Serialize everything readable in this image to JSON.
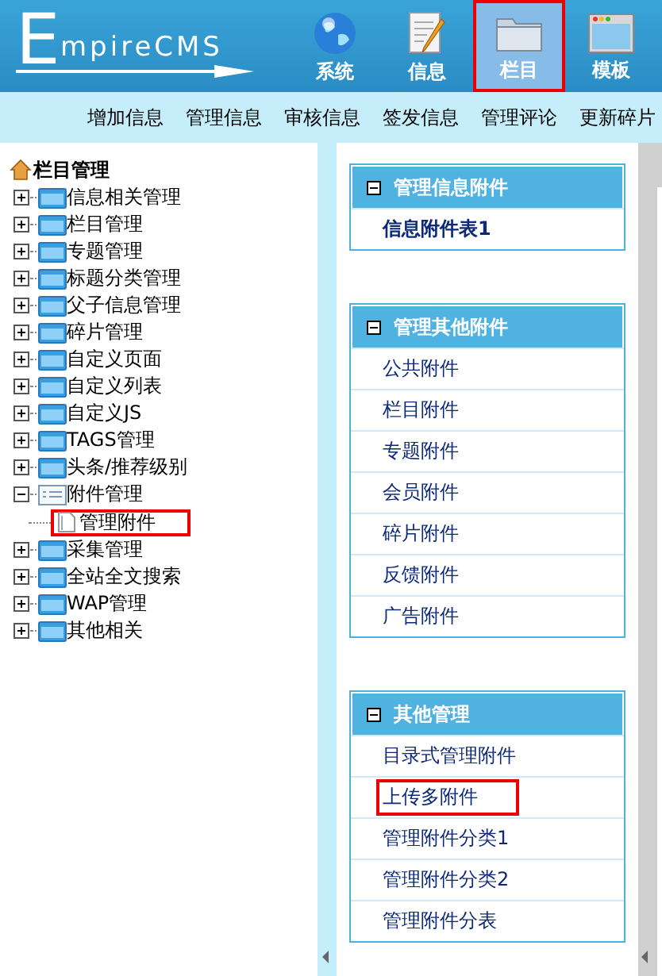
{
  "header": {
    "logo": {
      "initial": "E",
      "rest": "mpireCMS"
    },
    "menu": [
      {
        "label": "系统",
        "kind": "globe",
        "selected": false
      },
      {
        "label": "信息",
        "kind": "notepad",
        "selected": false
      },
      {
        "label": "栏目",
        "kind": "folder",
        "selected": true
      },
      {
        "label": "模板",
        "kind": "window",
        "selected": false
      }
    ]
  },
  "toolbar": [
    "增加信息",
    "管理信息",
    "审核信息",
    "签发信息",
    "管理评论",
    "更新碎片"
  ],
  "tree": {
    "title": "栏目管理",
    "items": [
      {
        "label": "信息相关管理",
        "expanded": false
      },
      {
        "label": "栏目管理",
        "expanded": false
      },
      {
        "label": "专题管理",
        "expanded": false
      },
      {
        "label": "标题分类管理",
        "expanded": false
      },
      {
        "label": "父子信息管理",
        "expanded": false
      },
      {
        "label": "碎片管理",
        "expanded": false
      },
      {
        "label": "自定义页面",
        "expanded": false
      },
      {
        "label": "自定义列表",
        "expanded": false
      },
      {
        "label": "自定义JS",
        "expanded": false
      },
      {
        "label": "TAGS管理",
        "expanded": false
      },
      {
        "label": "头条/推荐级别",
        "expanded": false
      },
      {
        "label": "附件管理",
        "expanded": true,
        "children": [
          {
            "label": "管理附件",
            "selected": true
          }
        ]
      },
      {
        "label": "采集管理",
        "expanded": false
      },
      {
        "label": "全站全文搜索",
        "expanded": false
      },
      {
        "label": "WAP管理",
        "expanded": false
      },
      {
        "label": "其他相关",
        "expanded": false
      }
    ]
  },
  "panels": [
    {
      "title": "管理信息附件",
      "items": [
        {
          "label": "信息附件表1",
          "bold": true,
          "selected": false
        }
      ]
    },
    {
      "title": "管理其他附件",
      "items": [
        {
          "label": "公共附件",
          "bold": false,
          "selected": false
        },
        {
          "label": "栏目附件",
          "bold": false,
          "selected": false
        },
        {
          "label": "专题附件",
          "bold": false,
          "selected": false
        },
        {
          "label": "会员附件",
          "bold": false,
          "selected": false
        },
        {
          "label": "碎片附件",
          "bold": false,
          "selected": false
        },
        {
          "label": "反馈附件",
          "bold": false,
          "selected": false
        },
        {
          "label": "广告附件",
          "bold": false,
          "selected": false
        }
      ]
    },
    {
      "title": "其他管理",
      "items": [
        {
          "label": "目录式管理附件",
          "bold": false,
          "selected": false
        },
        {
          "label": "上传多附件",
          "bold": false,
          "selected": true
        },
        {
          "label": "管理附件分类1",
          "bold": false,
          "selected": false
        },
        {
          "label": "管理附件分类2",
          "bold": false,
          "selected": false
        },
        {
          "label": "管理附件分表",
          "bold": false,
          "selected": false
        }
      ]
    }
  ]
}
